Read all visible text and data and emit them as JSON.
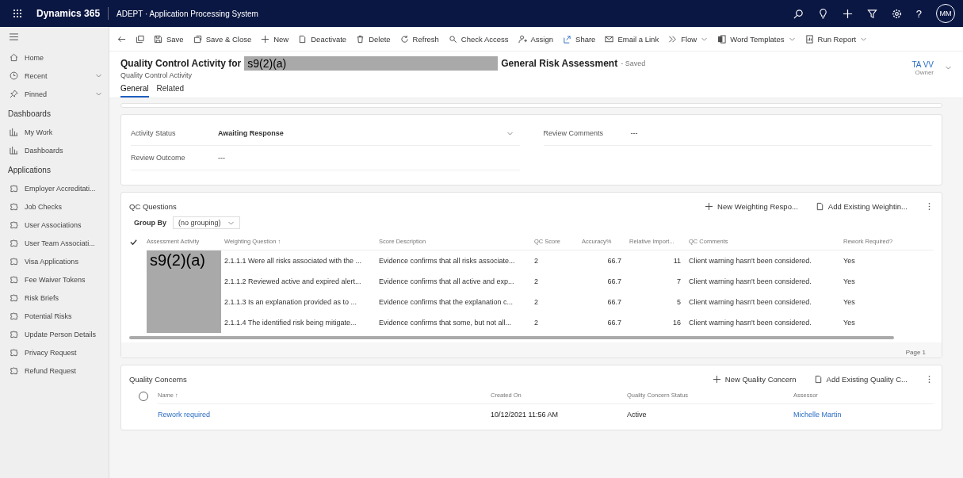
{
  "top_bar": {
    "app_name": "Dynamics 365",
    "area_title": "ADEPT · Application Processing System",
    "avatar": "MM",
    "help": "?"
  },
  "command_bar": [
    {
      "label": "Save",
      "has_menu": false
    },
    {
      "label": "Save & Close",
      "has_menu": false
    },
    {
      "label": "New",
      "has_menu": false
    },
    {
      "label": "Deactivate",
      "has_menu": false
    },
    {
      "label": "Delete",
      "has_menu": false
    },
    {
      "label": "Refresh",
      "has_menu": false
    },
    {
      "label": "Check Access",
      "has_menu": false
    },
    {
      "label": "Assign",
      "has_menu": false
    },
    {
      "label": "Share",
      "has_menu": false
    },
    {
      "label": "Email a Link",
      "has_menu": false
    },
    {
      "label": "Flow",
      "has_menu": true
    },
    {
      "label": "Word Templates",
      "has_menu": true
    },
    {
      "label": "Run Report",
      "has_menu": true
    }
  ],
  "sidebar": {
    "top_items": [
      {
        "label": "Home",
        "expandable": false
      },
      {
        "label": "Recent",
        "expandable": true
      },
      {
        "label": "Pinned",
        "expandable": true
      }
    ],
    "groups": [
      {
        "title": "Dashboards",
        "items": [
          {
            "label": "My Work"
          },
          {
            "label": "Dashboards"
          }
        ]
      },
      {
        "title": "Applications",
        "items": [
          {
            "label": "Employer Accreditati..."
          },
          {
            "label": "Job Checks"
          },
          {
            "label": "User Associations"
          },
          {
            "label": "User Team Associati..."
          },
          {
            "label": "Visa Applications"
          },
          {
            "label": "Fee Waiver Tokens"
          },
          {
            "label": "Risk Briefs"
          },
          {
            "label": "Potential Risks"
          },
          {
            "label": "Update Person Details"
          },
          {
            "label": "Privacy Request"
          },
          {
            "label": "Refund Request"
          }
        ]
      }
    ]
  },
  "header": {
    "title_prefix": "Quality Control Activity for",
    "redaction": "s9(2)(a)",
    "title_suffix": "General Risk Assessment",
    "save_status": "- Saved",
    "entity": "Quality Control Activity",
    "owner": "TA VV",
    "owner_label": "Owner"
  },
  "tabs": [
    {
      "label": "General",
      "selected": true
    },
    {
      "label": "Related",
      "selected": false
    }
  ],
  "summary": {
    "left_fields": [
      {
        "label": "Activity Status",
        "value": "Awaiting Response",
        "kind": "dropdown"
      },
      {
        "label": "Review Outcome",
        "value": "---",
        "kind": "text"
      }
    ],
    "right_fields": [
      {
        "label": "Review Comments",
        "value": "---",
        "kind": "text"
      }
    ]
  },
  "qc_questions": {
    "title": "QC Questions",
    "commands": [
      {
        "label": "New Weighting Respo...",
        "kind": "new"
      },
      {
        "label": "Add Existing Weightin...",
        "kind": "add"
      }
    ],
    "group_by_label": "Group By",
    "group_by_value": "(no grouping)",
    "columns": [
      "Assessment Activity",
      "Weighting Question ↑",
      "Score Description",
      "QC Score",
      "Accuracy%",
      "Relative Import...",
      "QC Comments",
      "Rework Required?"
    ],
    "redaction": "s9(2)(a)",
    "rows": [
      {
        "question": "2.1.1.1 Were all risks associated with the ...",
        "description": "Evidence confirms that all risks associate...",
        "score": "2",
        "accuracy": "66.7",
        "importance": "11",
        "comments": "Client warning hasn't been considered.",
        "rework": "Yes"
      },
      {
        "question": "2.1.1.2 Reviewed active and expired alert...",
        "description": "Evidence confirms that all active and exp...",
        "score": "2",
        "accuracy": "66.7",
        "importance": "7",
        "comments": "Client warning hasn't been considered.",
        "rework": "Yes"
      },
      {
        "question": "2.1.1.3 Is an explanation provided as to ...",
        "description": "Evidence confirms that the explanation c...",
        "score": "2",
        "accuracy": "66.7",
        "importance": "5",
        "comments": "Client warning hasn't been considered.",
        "rework": "Yes"
      },
      {
        "question": "2.1.1.4 The identified risk being mitigate...",
        "description": "Evidence confirms that some, but not all...",
        "score": "2",
        "accuracy": "66.7",
        "importance": "16",
        "comments": "Client warning hasn't been considered.",
        "rework": "Yes"
      }
    ],
    "pager": "Page 1"
  },
  "quality_concerns": {
    "title": "Quality Concerns",
    "commands": [
      {
        "label": "New Quality Concern",
        "kind": "new"
      },
      {
        "label": "Add Existing Quality C...",
        "kind": "add"
      }
    ],
    "select_all_checked": false,
    "columns": [
      "Name ↑",
      "Created On",
      "Quality Concern Status",
      "Assessor"
    ],
    "rows": [
      {
        "name": "Rework required",
        "created_on": "10/12/2021 11:56 AM",
        "status": "Active",
        "assessor": "Michelle Martin"
      }
    ]
  }
}
